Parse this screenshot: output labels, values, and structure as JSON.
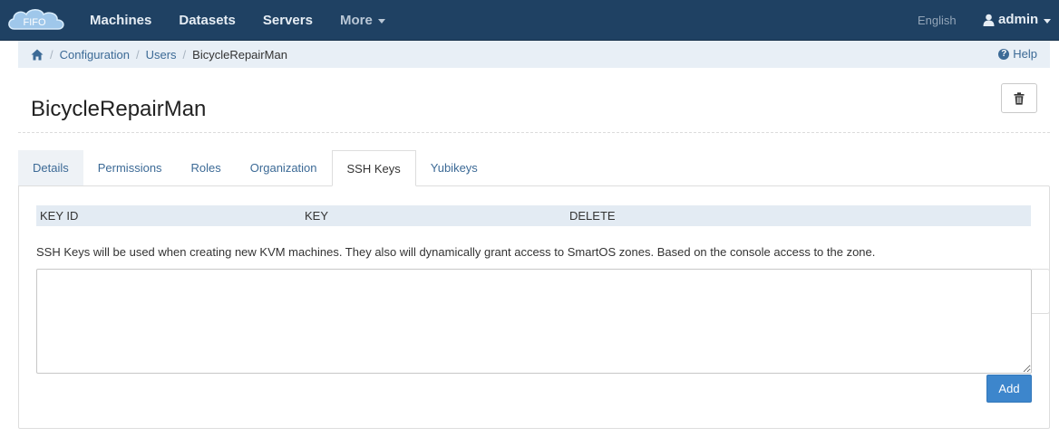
{
  "navbar": {
    "brand_text": "FIFO",
    "links": [
      "Machines",
      "Datasets",
      "Servers"
    ],
    "more_label": "More",
    "language": "English",
    "user": "admin"
  },
  "breadcrumb": {
    "items": [
      "Configuration",
      "Users"
    ],
    "current": "BicycleRepairMan",
    "help_label": "Help"
  },
  "page": {
    "title": "BicycleRepairMan"
  },
  "tabs": [
    "Details",
    "Permissions",
    "Roles",
    "Organization",
    "SSH Keys",
    "Yubikeys"
  ],
  "active_tab": "SSH Keys",
  "ssh_keys": {
    "columns": [
      "KEY ID",
      "KEY",
      "DELETE"
    ],
    "rows": [],
    "info": "SSH Keys will be used when creating new KVM machines. They also will dynamically grant access to SmartOS zones. Based on the console access to the zone.",
    "textarea_value": "",
    "add_label": "Add"
  },
  "colors": {
    "navbar": "#1f4163",
    "breadcrumb_bg": "#e8eff6",
    "link": "#3c6a96",
    "primary_button": "#3d86cc"
  }
}
